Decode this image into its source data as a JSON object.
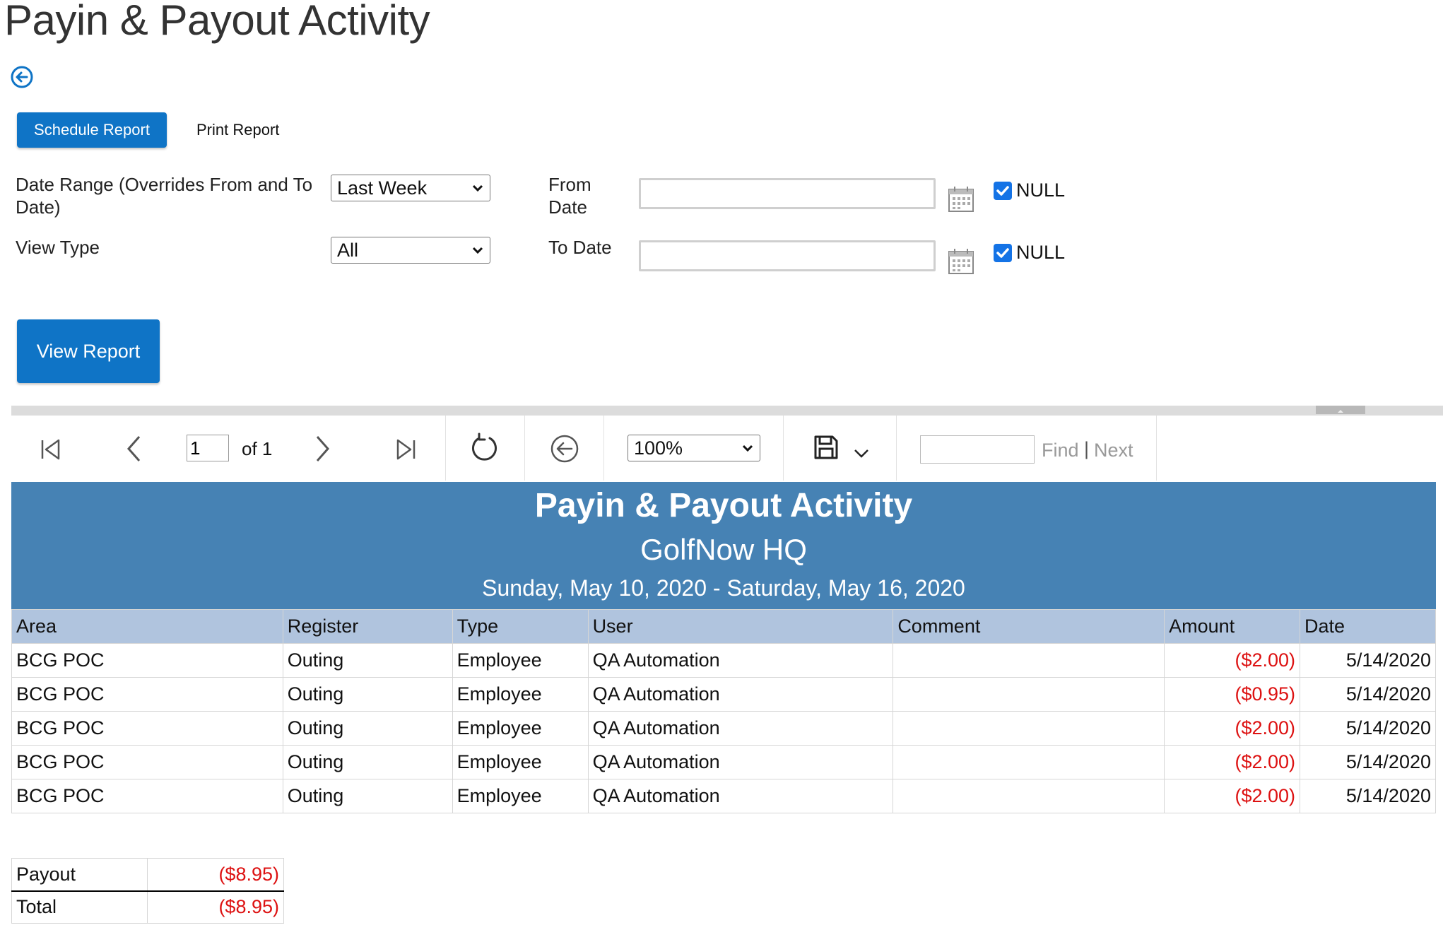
{
  "page": {
    "title": "Payin & Payout Activity"
  },
  "actions": {
    "schedule_label": "Schedule Report",
    "print_label": "Print Report",
    "view_report_label": "View Report"
  },
  "params": {
    "date_range": {
      "label": "Date Range (Overrides From and To Date)",
      "value": "Last Week"
    },
    "view_type": {
      "label": "View Type",
      "value": "All"
    },
    "from_date": {
      "label": "From Date",
      "value": "",
      "null_label": "NULL",
      "null_checked": true
    },
    "to_date": {
      "label": "To Date",
      "value": "",
      "null_label": "NULL",
      "null_checked": true
    }
  },
  "toolbar": {
    "page_number": "1",
    "page_of": "of 1",
    "zoom": "100%",
    "find_value": "",
    "find_label": "Find",
    "find_separator": "|",
    "next_label": "Next"
  },
  "report": {
    "title": "Payin & Payout Activity",
    "subtitle": "GolfNow HQ",
    "date_range": "Sunday, May 10, 2020 - Saturday, May 16, 2020",
    "columns": [
      "Area",
      "Register",
      "Type",
      "User",
      "Comment",
      "Amount",
      "Date"
    ],
    "rows": [
      [
        "BCG POC",
        "Outing",
        "Employee",
        "QA Automation",
        "",
        "($2.00)",
        "5/14/2020"
      ],
      [
        "BCG POC",
        "Outing",
        "Employee",
        "QA Automation",
        "",
        "($0.95)",
        "5/14/2020"
      ],
      [
        "BCG POC",
        "Outing",
        "Employee",
        "QA Automation",
        "",
        "($2.00)",
        "5/14/2020"
      ],
      [
        "BCG POC",
        "Outing",
        "Employee",
        "QA Automation",
        "",
        "($2.00)",
        "5/14/2020"
      ],
      [
        "BCG POC",
        "Outing",
        "Employee",
        "QA Automation",
        "",
        "($2.00)",
        "5/14/2020"
      ]
    ],
    "totals": [
      {
        "label": "Payout",
        "value": "($8.95)"
      },
      {
        "label": "Total",
        "value": "($8.95)"
      }
    ]
  },
  "colors": {
    "primary_button": "#0f74c6",
    "report_header": "#4682b4",
    "table_header": "#b0c4de",
    "negative_amount": "#dd1111",
    "checkbox": "#1473e6"
  }
}
